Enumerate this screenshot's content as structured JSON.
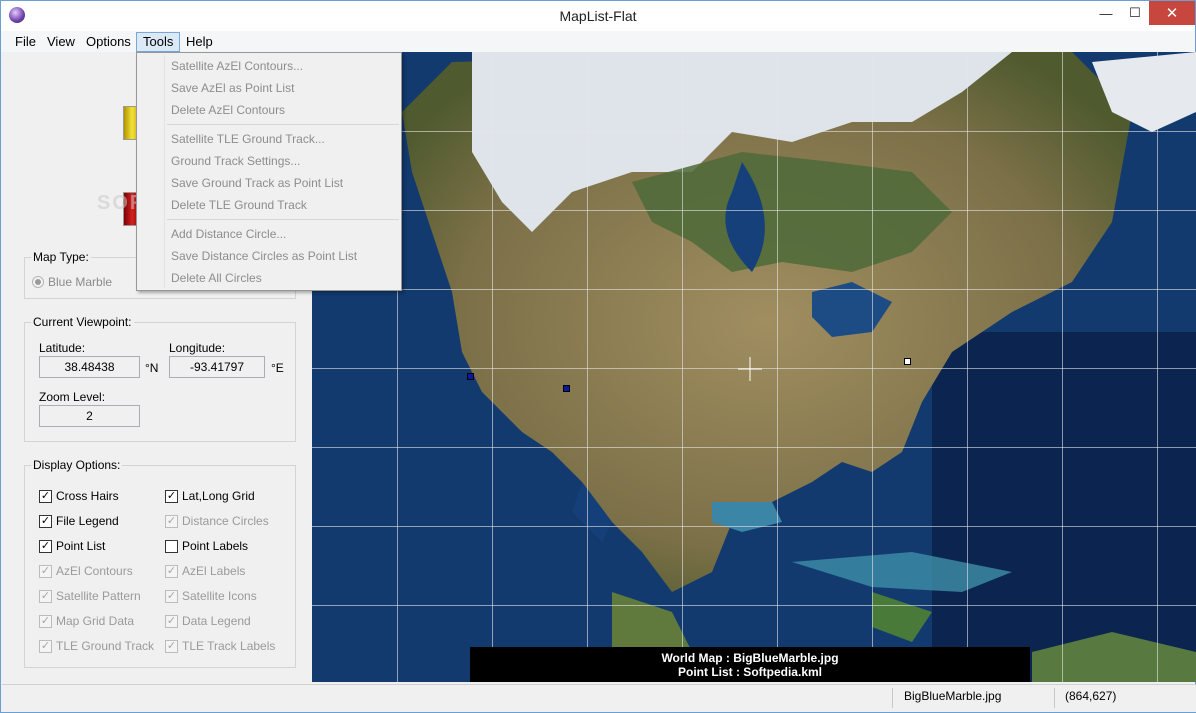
{
  "window": {
    "title": "MapList-Flat",
    "minimize": "—",
    "maximize": "☐",
    "close": "✕"
  },
  "menu": [
    "File",
    "View",
    "Options",
    "Tools",
    "Help"
  ],
  "tools_menu": {
    "items": [
      "Satellite AzEl Contours...",
      "Save AzEl as Point List",
      "Delete AzEl Contours",
      "Satellite TLE Ground Track...",
      "Ground Track Settings...",
      "Save Ground Track as Point List",
      "Delete TLE Ground Track",
      "Add Distance Circle...",
      "Save Distance Circles as Point List",
      "Delete All Circles"
    ]
  },
  "map_type": {
    "title": "Map Type:",
    "option_blue_marble": "Blue Marble"
  },
  "viewpoint": {
    "title": "Current Viewpoint:",
    "latitude_label": "Latitude:",
    "latitude_value": "38.48438",
    "latitude_unit": "°N",
    "longitude_label": "Longitude:",
    "longitude_value": "-93.41797",
    "longitude_unit": "°E",
    "zoom_label": "Zoom Level:",
    "zoom_value": "2"
  },
  "display_options": {
    "title": "Display Options:",
    "cross_hairs": "Cross Hairs",
    "lat_long_grid": "Lat,Long Grid",
    "file_legend": "File Legend",
    "distance_circles": "Distance Circles",
    "point_list": "Point List",
    "point_labels": "Point Labels",
    "azel_contours": "AzEl Contours",
    "azel_labels": "AzEl Labels",
    "satellite_pattern": "Satellite Pattern",
    "satellite_icons": "Satellite Icons",
    "map_grid_data": "Map Grid Data",
    "data_legend": "Data Legend",
    "tle_ground_track": "TLE Ground Track",
    "tle_track_labels": "TLE Track Labels"
  },
  "map": {
    "legend_line1": "World Map : BigBlueMarble.jpg",
    "legend_line2": "Point List : Softpedia.kml"
  },
  "status": {
    "file": "BigBlueMarble.jpg",
    "coords": "(864,627)"
  },
  "watermark": "SOFTPEDIA",
  "check_mark": "✓",
  "colors": {
    "ocean": "#0d2a55",
    "land": "#8a7a55",
    "snow": "#dfe4ea",
    "close_button": "#c7463e"
  }
}
